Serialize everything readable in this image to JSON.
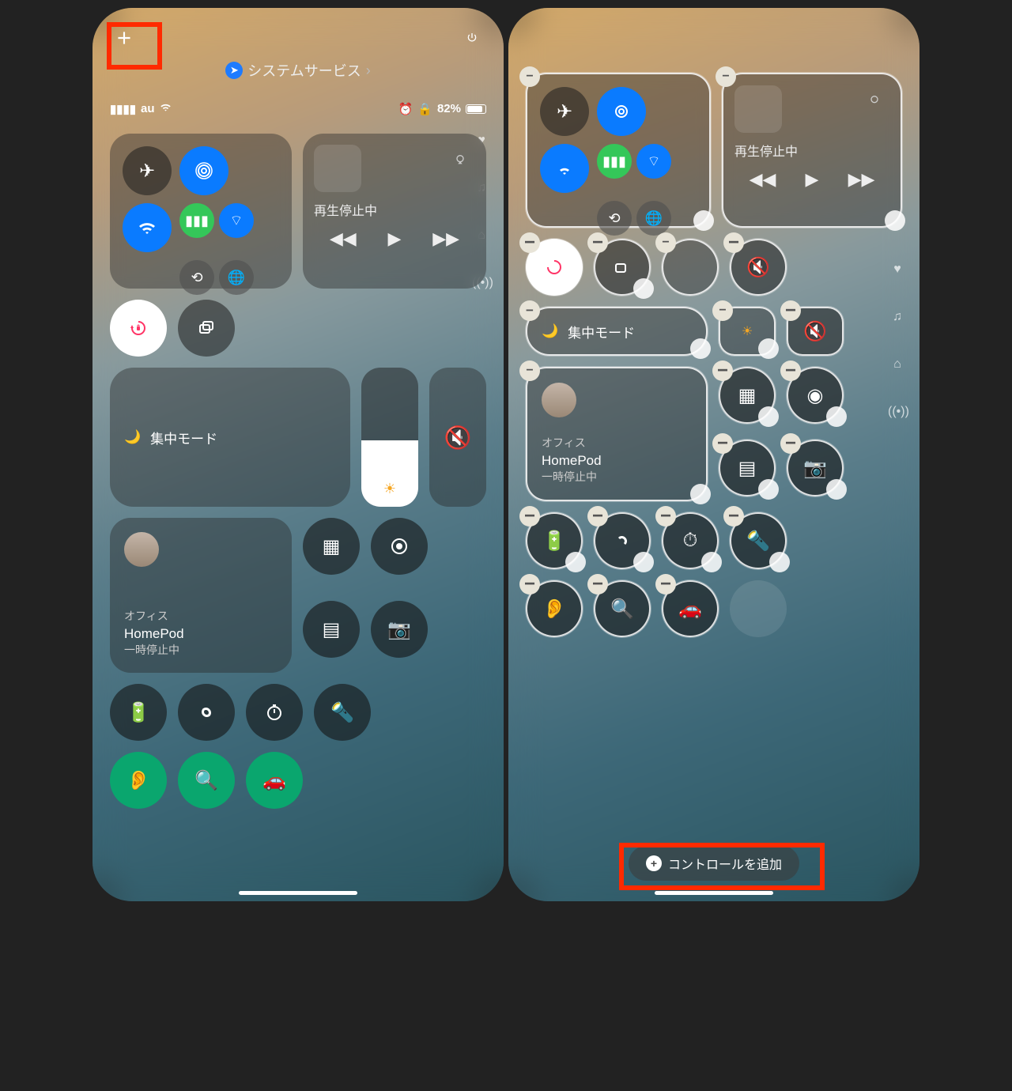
{
  "left": {
    "status": {
      "carrier": "au",
      "battery": "82%"
    },
    "location_label": "システムサービス",
    "media": {
      "title": "再生停止中"
    },
    "focus": {
      "label": "集中モード"
    },
    "homepod": {
      "room": "オフィス",
      "name": "HomePod",
      "state": "一時停止中"
    }
  },
  "right": {
    "media": {
      "title": "再生停止中"
    },
    "focus": {
      "label": "集中モード"
    },
    "homepod": {
      "room": "オフィス",
      "name": "HomePod",
      "state": "一時停止中"
    },
    "add_control": "コントロールを追加"
  }
}
